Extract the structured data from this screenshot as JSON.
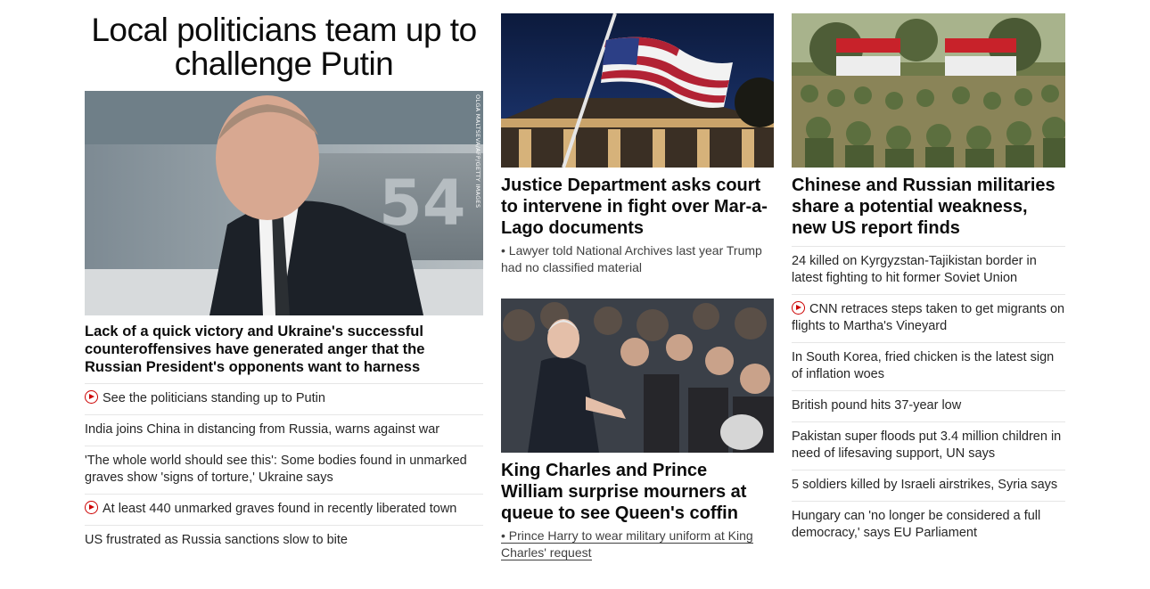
{
  "left": {
    "headline": "Local politicians team up to challenge Putin",
    "hero_credit": "OLGA MALTSEVA/AFP/GETTY IMAGES",
    "lead": "Lack of a quick victory and Ukraine's successful counteroffensives have generated anger that the Russian President's opponents want to harness",
    "stories": [
      {
        "text": "See the politicians standing up to Putin",
        "video": true
      },
      {
        "text": "India joins China in distancing from Russia, warns against war",
        "video": false
      },
      {
        "text": "'The whole world should see this': Some bodies found in unmarked graves show 'signs of torture,' Ukraine says",
        "video": false
      },
      {
        "text": "At least 440 unmarked graves found in recently liberated town",
        "video": true
      },
      {
        "text": "US frustrated as Russia sanctions slow to bite",
        "video": false
      }
    ]
  },
  "middle": {
    "card1": {
      "headline": "Justice Department asks court to intervene in fight over Mar-a-Lago documents",
      "sub": "• Lawyer told National Archives last year Trump had no classified material"
    },
    "card2": {
      "headline": "King Charles and Prince William surprise mourners at queue to see Queen's coffin",
      "sub": "• Prince Harry to wear military uniform at King Charles' request"
    }
  },
  "right": {
    "headline": "Chinese and Russian militaries share a potential weakness, new US report finds",
    "stories": [
      {
        "text": "24 killed on Kyrgyzstan-Tajikistan border in latest fighting to hit former Soviet Union",
        "video": false
      },
      {
        "text": "CNN retraces steps taken to get migrants on flights to Martha's Vineyard",
        "video": true
      },
      {
        "text": "In South Korea, fried chicken is the latest sign of inflation woes",
        "video": false
      },
      {
        "text": "British pound hits 37-year low",
        "video": false
      },
      {
        "text": "Pakistan super floods put 3.4 million children in need of lifesaving support, UN says",
        "video": false
      },
      {
        "text": "5 soldiers killed by Israeli airstrikes, Syria says",
        "video": false
      },
      {
        "text": "Hungary can 'no longer be considered a full democracy,' says EU Parliament",
        "video": false
      }
    ]
  },
  "colors": {
    "accent": "#cc0000",
    "text": "#0c0c0c",
    "divider": "#e6e6e6"
  }
}
